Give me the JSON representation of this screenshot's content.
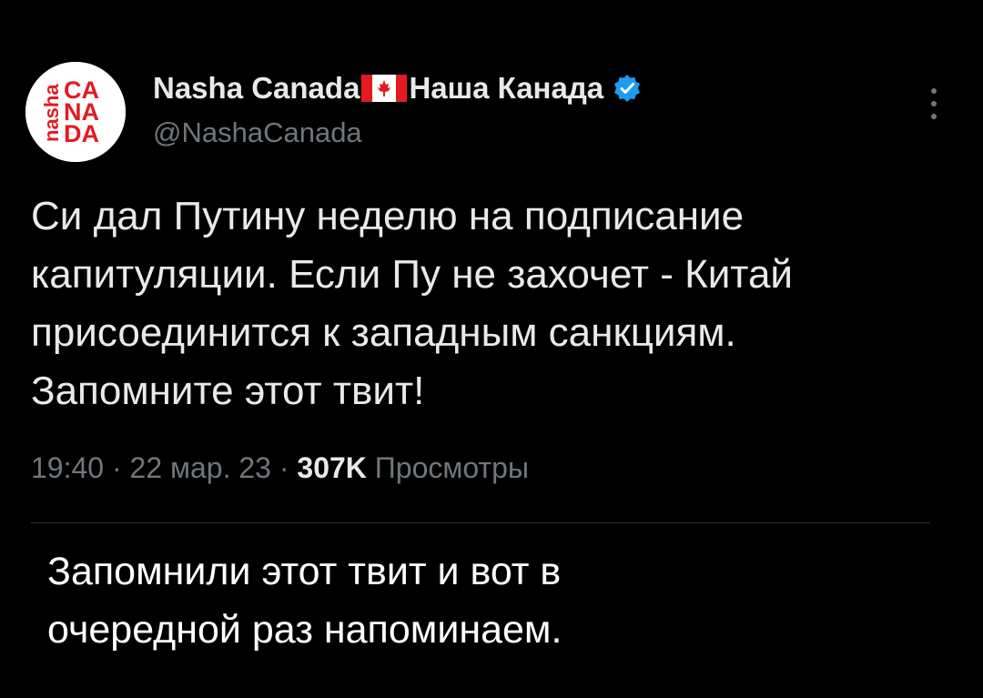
{
  "author": {
    "name_part1": "Nasha Canada",
    "name_part2": "Наша Канада",
    "handle": "@NashaCanada",
    "avatar_letters": {
      "vertical": "nasha",
      "rows": [
        "CA",
        "NA",
        "DA"
      ]
    },
    "verified": true,
    "verified_color": "#1d9bf0",
    "icons": [
      "canada-flag-icon",
      "verified-badge-icon",
      "more-icon"
    ]
  },
  "tweet": {
    "lines": [
      "Си дал Путину неделю на подписание",
      "капитуляции. Если Пу не захочет - Китай",
      "присоединится к западным санкциям.",
      "Запомните этот твит!"
    ]
  },
  "meta": {
    "time": "19:40",
    "date": "22 мар. 23",
    "views_count": "307K",
    "views_label": "Просмотры"
  },
  "caption": {
    "lines": [
      "Запомнили этот твит и вот в",
      "очередной раз напоминаем."
    ]
  },
  "colors": {
    "background": "#000000",
    "text": "#e7e9ea",
    "muted": "#71767b",
    "brand_red": "#e21b23"
  }
}
